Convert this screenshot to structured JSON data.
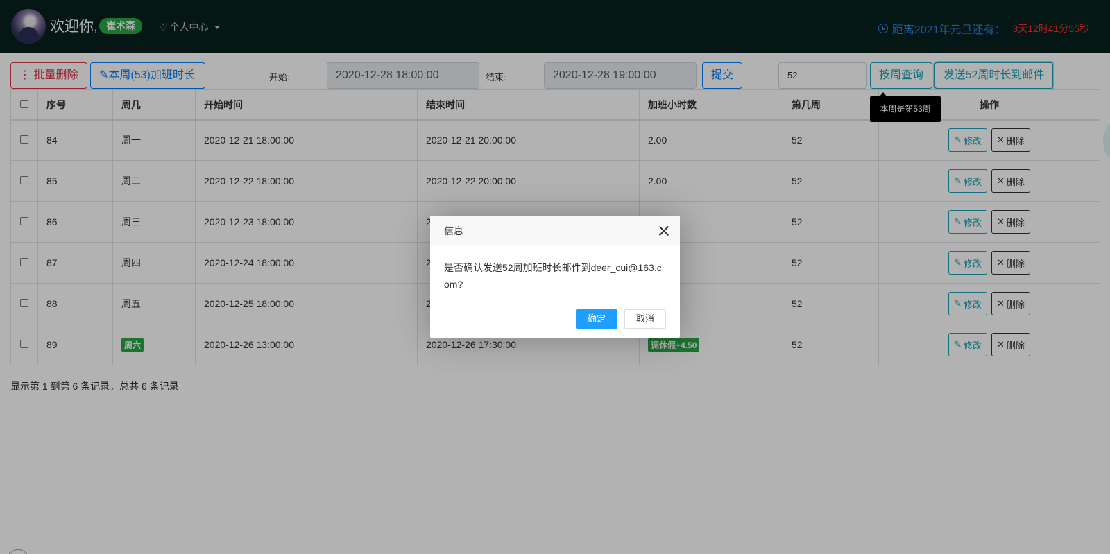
{
  "header": {
    "welcome": "欢迎你,",
    "username": "崔术森",
    "personal_center": "个人中心",
    "countdown_label": "距离2021年元旦还有：",
    "countdown_value": "3天12时41分55秒"
  },
  "toolbar": {
    "batch_delete": "批量删除",
    "week_overtime": "本周(53)加班时长",
    "start_label": "开始:",
    "start_value": "2020-12-28 18:00:00",
    "end_label": "结束:",
    "end_value": "2020-12-28 19:00:00",
    "submit": "提交",
    "week_value": "52",
    "query_by_week": "按周查询",
    "send_email": "发送52周时长到邮件",
    "tooltip": "本周是第53周"
  },
  "table": {
    "columns": [
      "序号",
      "周几",
      "开始时间",
      "结束时间",
      "加班小时数",
      "第几周",
      "操作"
    ],
    "rows": [
      {
        "id": "84",
        "weekday": "周一",
        "start": "2020-12-21 18:00:00",
        "end": "2020-12-21 20:00:00",
        "hours": "2.00",
        "week": "52"
      },
      {
        "id": "85",
        "weekday": "周二",
        "start": "2020-12-22 18:00:00",
        "end": "2020-12-22 20:00:00",
        "hours": "2.00",
        "week": "52"
      },
      {
        "id": "86",
        "weekday": "周三",
        "start": "2020-12-23 18:00:00",
        "end": "2",
        "hours": "",
        "week": "52"
      },
      {
        "id": "87",
        "weekday": "周四",
        "start": "2020-12-24 18:00:00",
        "end": "2",
        "hours": "",
        "week": "52"
      },
      {
        "id": "88",
        "weekday": "周五",
        "start": "2020-12-25 18:00:00",
        "end": "2",
        "hours": "",
        "week": "52"
      },
      {
        "id": "89",
        "weekday": "周六",
        "start": "2020-12-26 13:00:00",
        "end": "2020-12-26 17:30:00",
        "hours": "调休假+4.50",
        "week": "52"
      }
    ],
    "edit_label": "修改",
    "delete_label": "删除",
    "summary": "显示第 1 到第 6 条记录，总共 6 条记录"
  },
  "dialog": {
    "title": "信息",
    "message": "是否确认发送52周加班时长邮件到deer_cui@163.com?",
    "ok": "确定",
    "cancel": "取消"
  },
  "colors": {
    "header_bg": "#08221f",
    "accent_blue": "#007bff",
    "accent_teal": "#17a2b8",
    "danger": "#dc3545",
    "success": "#28a745",
    "dialog_ok": "#1e9fff"
  }
}
